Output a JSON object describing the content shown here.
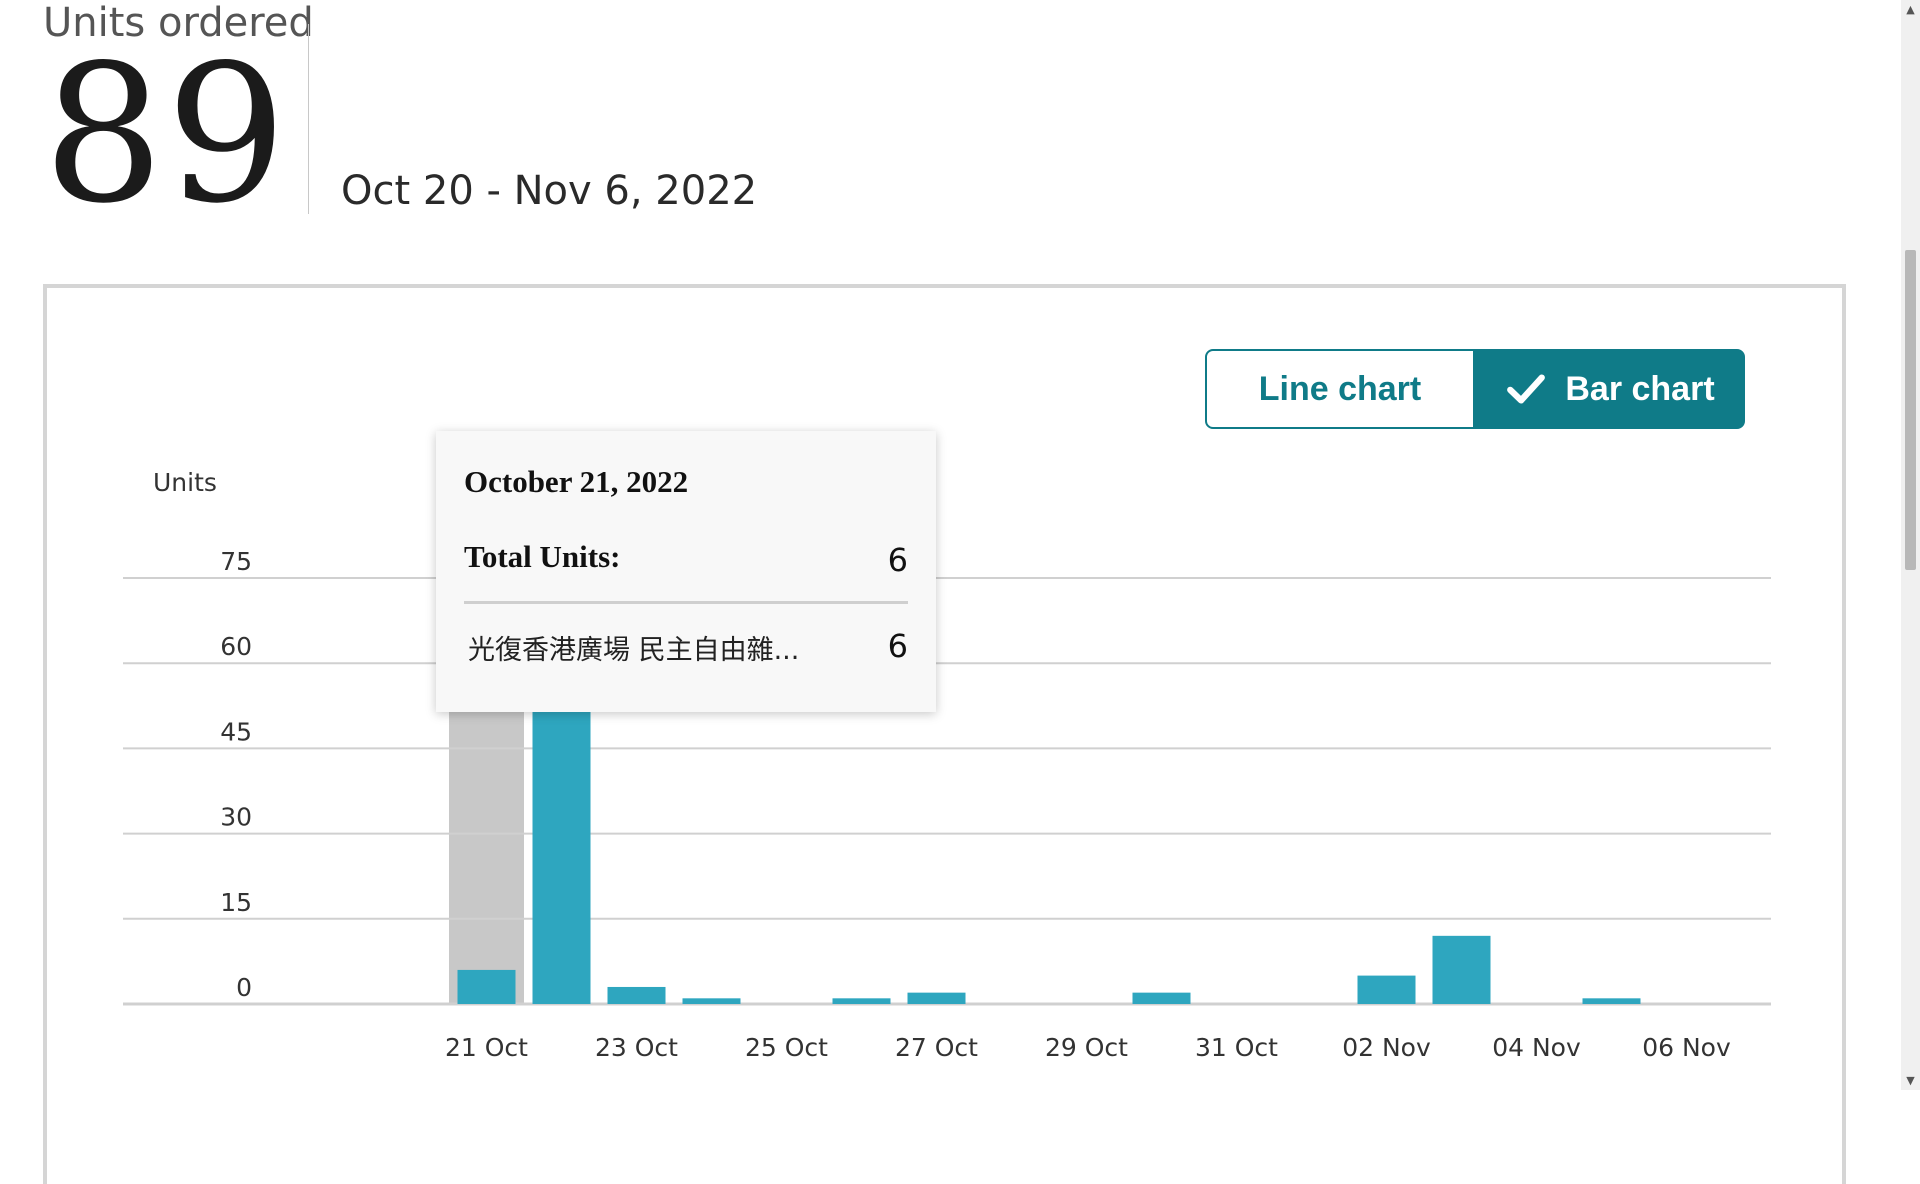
{
  "metric": {
    "label": "Units ordered",
    "value": "89",
    "date_range": "Oct 20 - Nov 6, 2022"
  },
  "toggle": {
    "line_label": "Line chart",
    "bar_label": "Bar chart",
    "selected": "bar"
  },
  "colors": {
    "bar": "#2ea6bf",
    "highlight": "#c8c8c8",
    "grid": "#d0d0d0",
    "accent": "#0f7b88"
  },
  "tooltip": {
    "title": "October 21, 2022",
    "total_label": "Total Units:",
    "total_value": "6",
    "item_label": "光復香港廣場 民主自由雜...",
    "item_value": "6"
  },
  "chart_data": {
    "type": "bar",
    "ylabel": "Units",
    "ylim": [
      0,
      75
    ],
    "yticks": [
      "75",
      "60",
      "45",
      "30",
      "15",
      "0"
    ],
    "grid": true,
    "categories": [
      "20 Oct",
      "21 Oct",
      "22 Oct",
      "23 Oct",
      "24 Oct",
      "25 Oct",
      "26 Oct",
      "27 Oct",
      "28 Oct",
      "29 Oct",
      "30 Oct",
      "31 Oct",
      "01 Nov",
      "02 Nov",
      "03 Nov",
      "04 Nov",
      "05 Nov",
      "06 Nov"
    ],
    "values": [
      0,
      6,
      53,
      3,
      1,
      0,
      1,
      2,
      0,
      0,
      2,
      0,
      0,
      5,
      12,
      0,
      1,
      0
    ],
    "highlighted": "21 Oct",
    "xtick_labels": [
      "21 Oct",
      "23 Oct",
      "25 Oct",
      "27 Oct",
      "29 Oct",
      "31 Oct",
      "02 Nov",
      "04 Nov",
      "06 Nov"
    ]
  }
}
